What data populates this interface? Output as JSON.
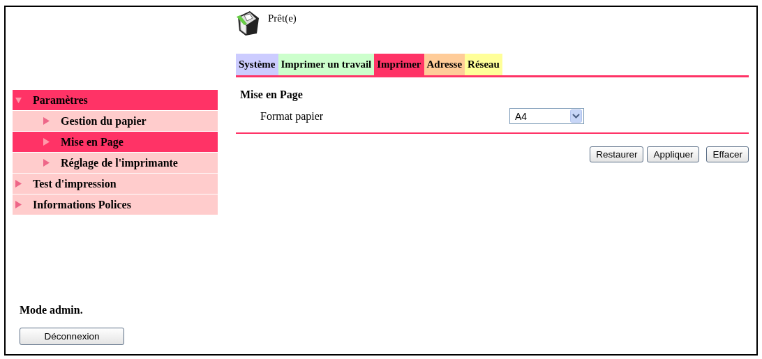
{
  "status": {
    "text": "Prêt(e)"
  },
  "tabs": [
    {
      "label": "Système",
      "selected": false,
      "color": "#ccccff"
    },
    {
      "label": "Imprimer un travail",
      "selected": false,
      "color": "#ccffcc"
    },
    {
      "label": "Imprimer",
      "selected": true,
      "color": "#ff3366"
    },
    {
      "label": "Adresse",
      "selected": false,
      "color": "#ffcc99"
    },
    {
      "label": "Réseau",
      "selected": false,
      "color": "#ffff99"
    }
  ],
  "sidebar": {
    "items": [
      {
        "label": "Paramètres",
        "selected": true,
        "expanded": true,
        "children": [
          {
            "label": "Gestion du papier",
            "selected": false
          },
          {
            "label": "Mise en Page",
            "selected": true
          },
          {
            "label": "Réglage de l'imprimante",
            "selected": false
          }
        ]
      },
      {
        "label": "Test d'impression",
        "selected": false,
        "expanded": false
      },
      {
        "label": "Informations Polices",
        "selected": false,
        "expanded": false
      }
    ]
  },
  "admin": {
    "label": "Mode admin.",
    "logout_button": "Déconnexion"
  },
  "section": {
    "title": "Mise en Page",
    "fields": [
      {
        "label": "Format papier",
        "value": "A4"
      }
    ]
  },
  "buttons": [
    "Restaurer",
    "Appliquer",
    "Effacer"
  ]
}
